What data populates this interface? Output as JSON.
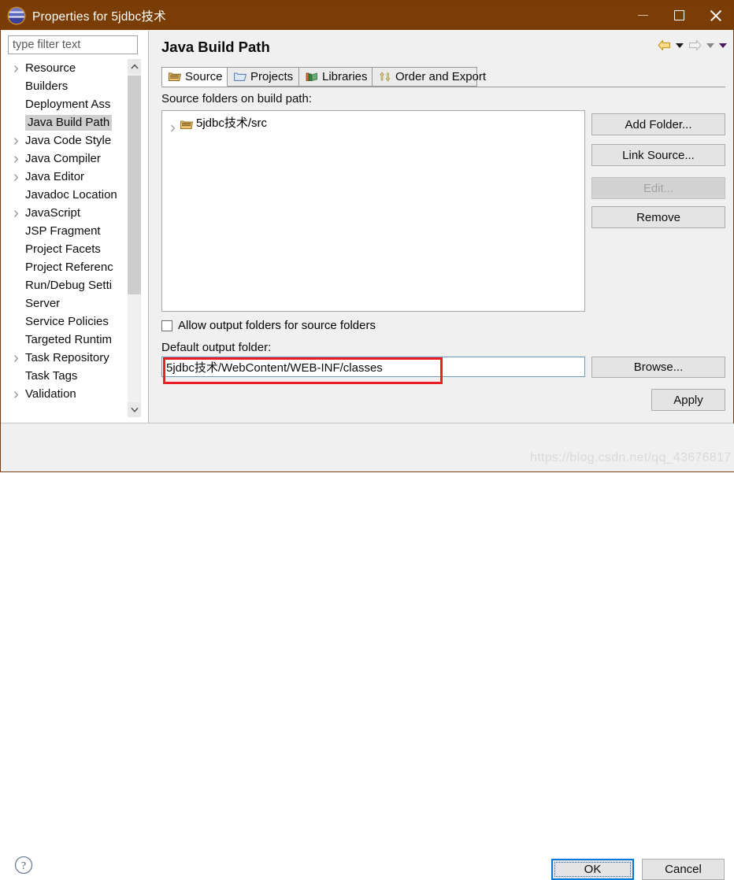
{
  "window": {
    "title": "Properties for 5jdbc技术",
    "app_icon": "eclipse-globe-icon",
    "minimize_label": "Minimize",
    "maximize_label": "Maximize",
    "close_label": "Close",
    "titlebar_color": "#7a3d05"
  },
  "sidebar": {
    "filter_placeholder": "type filter text",
    "filter_value": "",
    "items": [
      {
        "label": "Resource",
        "expandable": true,
        "selected": false
      },
      {
        "label": "Builders",
        "expandable": false,
        "selected": false
      },
      {
        "label": "Deployment Ass",
        "expandable": false,
        "selected": false
      },
      {
        "label": "Java Build Path",
        "expandable": false,
        "selected": true
      },
      {
        "label": "Java Code Style",
        "expandable": true,
        "selected": false
      },
      {
        "label": "Java Compiler",
        "expandable": true,
        "selected": false
      },
      {
        "label": "Java Editor",
        "expandable": true,
        "selected": false
      },
      {
        "label": "Javadoc Location",
        "expandable": false,
        "selected": false
      },
      {
        "label": "JavaScript",
        "expandable": true,
        "selected": false
      },
      {
        "label": "JSP Fragment",
        "expandable": false,
        "selected": false
      },
      {
        "label": "Project Facets",
        "expandable": false,
        "selected": false
      },
      {
        "label": "Project Referenc",
        "expandable": false,
        "selected": false
      },
      {
        "label": "Run/Debug Setti",
        "expandable": false,
        "selected": false
      },
      {
        "label": "Server",
        "expandable": false,
        "selected": false
      },
      {
        "label": "Service Policies",
        "expandable": false,
        "selected": false
      },
      {
        "label": "Targeted Runtim",
        "expandable": false,
        "selected": false
      },
      {
        "label": "Task Repository",
        "expandable": true,
        "selected": false
      },
      {
        "label": "Task Tags",
        "expandable": false,
        "selected": false
      },
      {
        "label": "Validation",
        "expandable": true,
        "selected": false
      }
    ]
  },
  "main": {
    "page_title": "Java Build Path",
    "nav": {
      "back_icon": "back-arrow-icon",
      "back_menu_icon": "chevron-down-icon",
      "forward_icon": "forward-arrow-icon",
      "forward_menu_icon": "chevron-down-icon",
      "overflow_menu_icon": "chevron-down-icon"
    },
    "tabs": [
      {
        "label": "Source",
        "icon": "source-folder-icon",
        "active": true
      },
      {
        "label": "Projects",
        "icon": "projects-folder-icon",
        "active": false
      },
      {
        "label": "Libraries",
        "icon": "libraries-books-icon",
        "active": false
      },
      {
        "label": "Order and Export",
        "icon": "order-arrows-icon",
        "active": false
      }
    ],
    "source_section_label": "Source folders on build path:",
    "source_entries": [
      {
        "label": "5jdbc技术/src",
        "icon": "package-folder-icon",
        "expandable": true
      }
    ],
    "side_buttons": [
      {
        "label": "Add Folder...",
        "disabled": false
      },
      {
        "label": "Link Source...",
        "disabled": false
      },
      {
        "label": "Edit...",
        "disabled": true
      },
      {
        "label": "Remove",
        "disabled": false
      }
    ],
    "allow_output_checkbox": {
      "label": "Allow output folders for source folders",
      "checked": false
    },
    "default_output_label": "Default output folder:",
    "default_output_value": "5jdbc技术/WebContent/WEB-INF/classes",
    "browse_label": "Browse...",
    "apply_label": "Apply"
  },
  "footer": {
    "help_icon": "help-question-icon",
    "ok_label": "OK",
    "cancel_label": "Cancel"
  },
  "annotation": {
    "highlight_color": "#ee1c23",
    "watermark": "https://blog.csdn.net/qq_43676817"
  }
}
